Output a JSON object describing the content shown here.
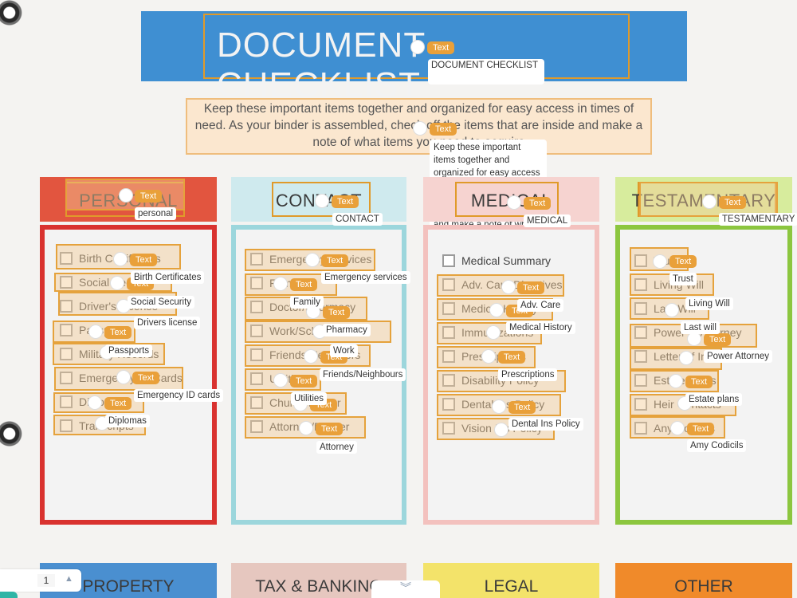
{
  "title": "DOCUMENT CHECKLIST",
  "intro": "Keep these important items together and organized for easy access in times of need. As your binder is assembled, check off the items that are inside and make a note of what items you need to acquire",
  "tag_label": "Text",
  "title_popup": "DOCUMENT CHECKLIST",
  "intro_popup": "Keep these important items together and organized for easy access in times of need. As your binder is assembled check for items that are inside and make a note of what items you need to acquire",
  "columns": [
    {
      "heading": "PERSONAL",
      "heading_popup": "personal",
      "color": "#e0443a",
      "items": [
        "Birth Certificates",
        "Social Security",
        "Driver's License",
        "Passports",
        "Military Records",
        "Emergency ID Cards",
        "Diplomas",
        "Transcripts"
      ],
      "popups": [
        "Birth Certificates",
        "Social Security",
        "Drivers license",
        "Passports",
        "Emergency ID cards",
        "Diplomas"
      ]
    },
    {
      "heading": "CONTACT",
      "heading_popup": "CONTACT",
      "color": "#8fd0d8",
      "items": [
        "Emergency Services",
        "Family",
        "Doctor/Pharmacy",
        "Work/School/Office",
        "Friends/Neighbors",
        "Utilities",
        "Church/Pastor",
        "Attorney/Banker"
      ],
      "popups": [
        "Emergency services",
        "Family",
        "Pharmacy",
        "Work",
        "Friends/Neighbours",
        "Utilities",
        "Attorney"
      ]
    },
    {
      "heading": "MEDICAL",
      "heading_popup": "MEDICAL",
      "color": "#f1b9b6",
      "items": [
        "Medical Summary",
        "Adv. Care Directives",
        "Medical History",
        "Immunizations",
        "Prescriptions",
        "Disability Policy",
        "Dental Ins Policy",
        "Vision Ins Policy"
      ],
      "popups": [
        "Adv. Care",
        "Medical History",
        "Prescriptions",
        "Dental Ins Policy"
      ]
    },
    {
      "heading": "TESTAMENTARY",
      "heading_popup": "TESTAMENTARY",
      "color": "#8cc63f",
      "items": [
        "Trust",
        "Living Will",
        "Last Will",
        "Power of Attorney",
        "Letter of Intent",
        "Estate Plans",
        "Heir Contacts",
        "Any Codicils"
      ],
      "popups": [
        "Trust",
        "Living Will",
        "Last will",
        "Power Attorney",
        "Estate plans",
        "Amy Codicils"
      ]
    }
  ],
  "bottom_headings": [
    "PROPERTY",
    "TAX & BANKING",
    "LEGAL",
    "OTHER"
  ],
  "bottom_colors": [
    "#4a8fd0",
    "#e6c7bf",
    "#f3e36a",
    "#f08a2a"
  ],
  "pager": {
    "page": "1",
    "up_icon": "chevron-up-icon"
  },
  "expand_icon": "double-chevron-down-icon"
}
